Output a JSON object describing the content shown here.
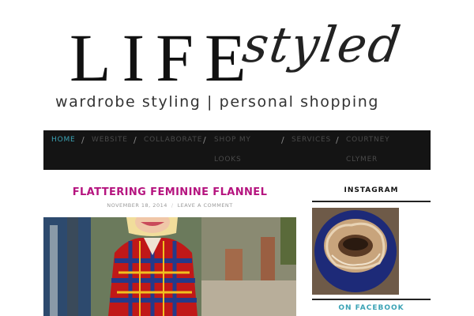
{
  "header": {
    "logo_main": "LIFE",
    "logo_script": "styled",
    "tagline": "wardrobe styling | personal shopping"
  },
  "nav": {
    "items": [
      {
        "label": "HOME",
        "label2": ""
      },
      {
        "label": "WEBSITE",
        "label2": ""
      },
      {
        "label": "COLLABORATE",
        "label2": ""
      },
      {
        "label": "SHOP MY",
        "label2": "LOOKS"
      },
      {
        "label": "SERVICES",
        "label2": ""
      },
      {
        "label": "COURTNEY",
        "label2": "CLYMER"
      }
    ],
    "separator": "/",
    "active_color": "#3ba3b5"
  },
  "post": {
    "title": "FLATTERING FEMININE FLANNEL",
    "date": "NOVEMBER 18, 2014",
    "meta_separator": "/",
    "comment_link": "LEAVE A COMMENT",
    "title_color": "#b5147f"
  },
  "sidebar": {
    "instagram_title": "INSTAGRAM",
    "facebook_title": "ON FACEBOOK"
  }
}
